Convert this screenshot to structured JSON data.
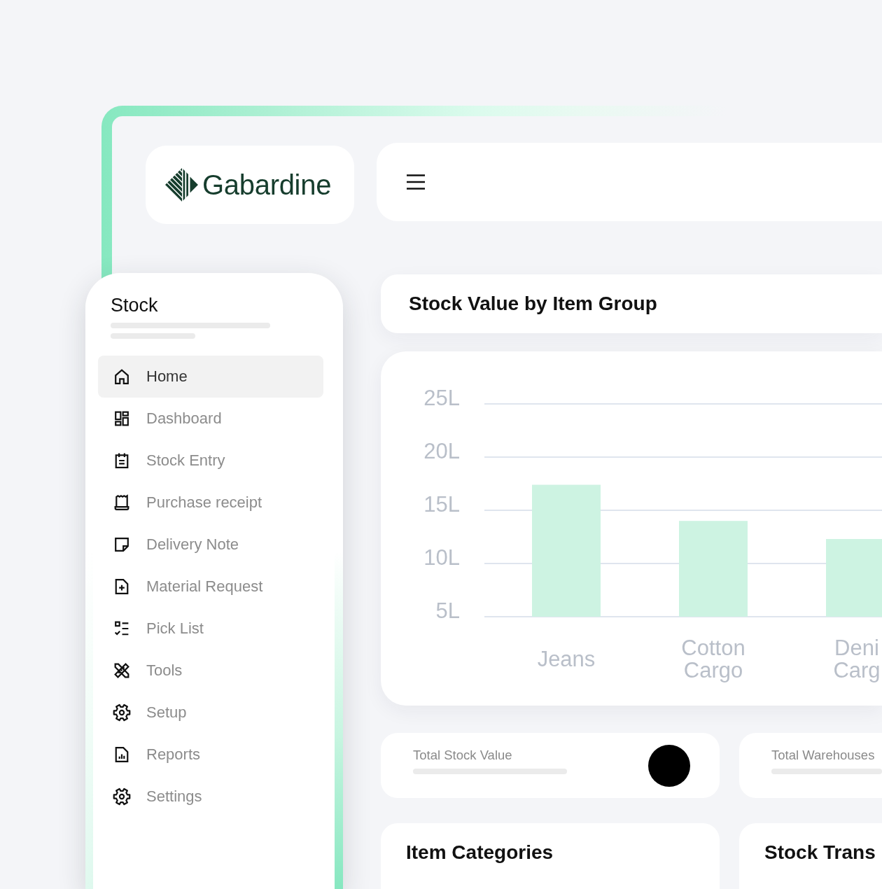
{
  "logo": {
    "text": "Gabardine"
  },
  "sidebar": {
    "title": "Stock",
    "items": [
      {
        "label": "Home",
        "selected": true
      },
      {
        "label": "Dashboard",
        "selected": false
      },
      {
        "label": "Stock Entry",
        "selected": false
      },
      {
        "label": "Purchase receipt",
        "selected": false
      },
      {
        "label": "Delivery Note",
        "selected": false
      },
      {
        "label": "Material Request",
        "selected": false
      },
      {
        "label": "Pick List",
        "selected": false
      },
      {
        "label": "Tools",
        "selected": false
      },
      {
        "label": "Setup",
        "selected": false
      },
      {
        "label": "Reports",
        "selected": false
      },
      {
        "label": "Settings",
        "selected": false
      }
    ]
  },
  "chart_panel": {
    "title": "Stock Value by Item Group",
    "chart_data": {
      "type": "bar",
      "categories": [
        "Jeans",
        "Cotton Cargo",
        "Deni Carg"
      ],
      "values": [
        17.4,
        14.0,
        12.3
      ],
      "ylim": [
        5,
        25
      ],
      "yticks": [
        {
          "value": 5,
          "label": "5L"
        },
        {
          "value": 10,
          "label": "10L"
        },
        {
          "value": 15,
          "label": "15L"
        },
        {
          "value": 20,
          "label": "20L"
        },
        {
          "value": 25,
          "label": "25L"
        }
      ],
      "grid": true
    }
  },
  "stat_cards": [
    {
      "label": "Total Stock Value",
      "has_icon": true
    },
    {
      "label": "Total Warehouses",
      "has_icon": false
    }
  ],
  "panels": [
    {
      "title": "Item Categories"
    },
    {
      "title": "Stock Trans"
    }
  ]
}
